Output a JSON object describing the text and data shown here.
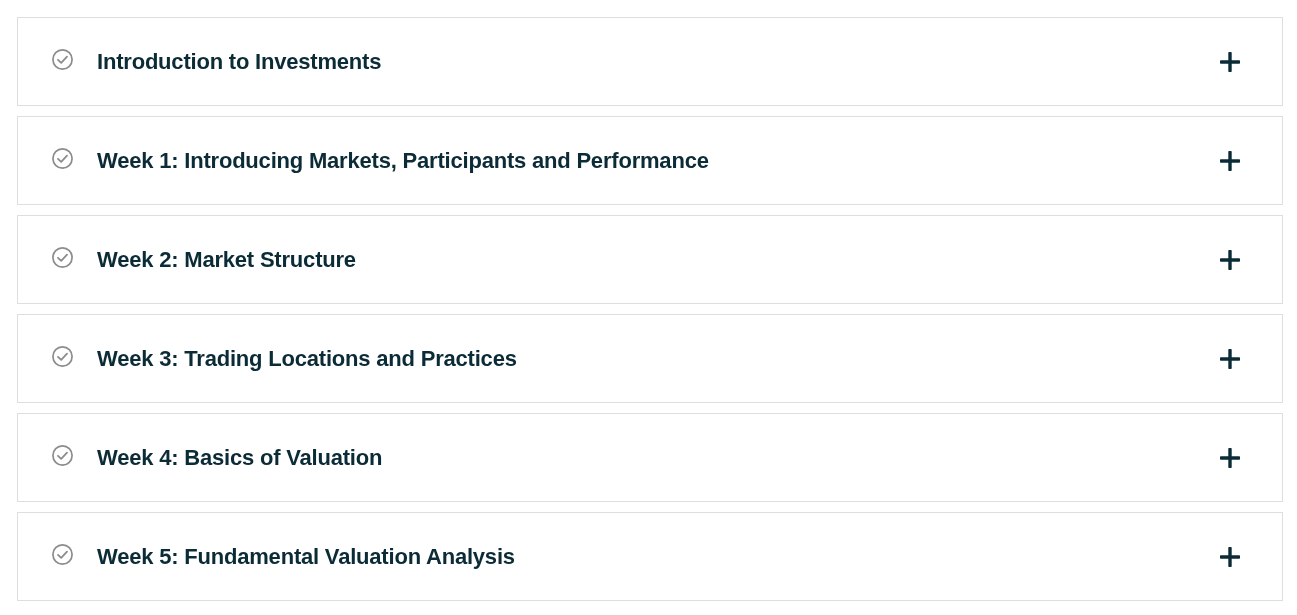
{
  "accordion": [
    {
      "title": "Introduction to Investments",
      "expanded": false
    },
    {
      "title": "Week 1: Introducing Markets, Participants and Performance",
      "expanded": false
    },
    {
      "title": "Week 2: Market Structure",
      "expanded": false
    },
    {
      "title": "Week 3: Trading Locations and Practices",
      "expanded": false
    },
    {
      "title": "Week 4: Basics of Valuation",
      "expanded": false
    },
    {
      "title": "Week 5: Fundamental Valuation Analysis",
      "expanded": false
    }
  ]
}
